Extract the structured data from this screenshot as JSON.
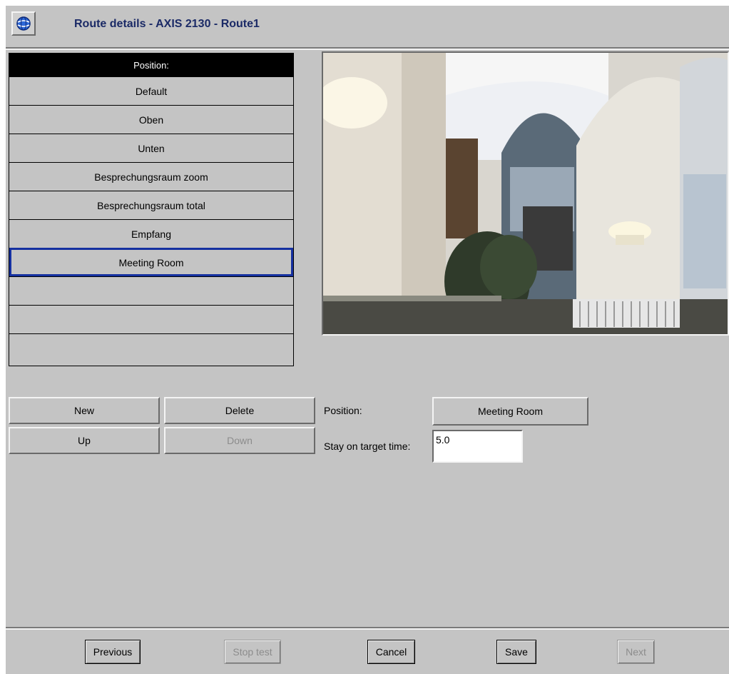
{
  "header": {
    "title": "Route details  - AXIS 2130 - Route1",
    "icon": "globe-icon"
  },
  "positions": {
    "header": "Position:",
    "items": [
      "Default",
      "Oben",
      "Unten",
      "Besprechungsraum zoom",
      "Besprechungsraum total",
      "Empfang",
      "Meeting Room",
      "",
      "",
      ""
    ],
    "selected": "Meeting Room"
  },
  "buttons": {
    "new": "New",
    "delete": "Delete",
    "up": "Up",
    "down": "Down"
  },
  "form": {
    "position_label": "Position:",
    "position_value": "Meeting Room",
    "stay_label": "Stay on target time:",
    "stay_value": "5.0"
  },
  "footer": {
    "previous": "Previous",
    "stop_test": "Stop test",
    "cancel": "Cancel",
    "save": "Save",
    "next": "Next"
  },
  "colors": {
    "background": "#c4c4c4",
    "title": "#1b2a66",
    "selection": "#1530a0"
  }
}
